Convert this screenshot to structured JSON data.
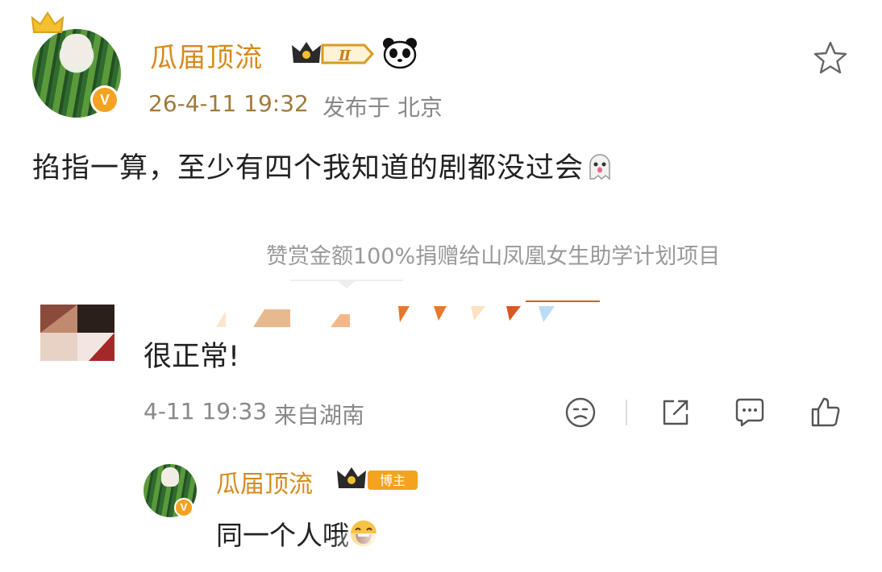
{
  "post": {
    "author": "瓜届顶流",
    "level": "Ⅱ",
    "time": "26-4-11 19:32",
    "location": "发布于 北京",
    "text": "掐指一算，至少有四个我知道的剧都没过会",
    "verified_mark": "V"
  },
  "reward": {
    "text": "赞赏金额100%捐赠给山凤凰女生助学计划项目"
  },
  "comment": {
    "text": "很正常!",
    "time": "4-11 19:33",
    "location": "来自湖南",
    "actions": [
      "dislike-icon",
      "share-icon",
      "comment-icon",
      "like-icon"
    ]
  },
  "reply": {
    "author": "瓜届顶流",
    "badge_label": "博主",
    "text": "同一个人哦",
    "verified_mark": "V"
  },
  "colors": {
    "author_name": "#d68a1c",
    "meta_gray": "#888888",
    "vip_orange": "#f4a321"
  }
}
